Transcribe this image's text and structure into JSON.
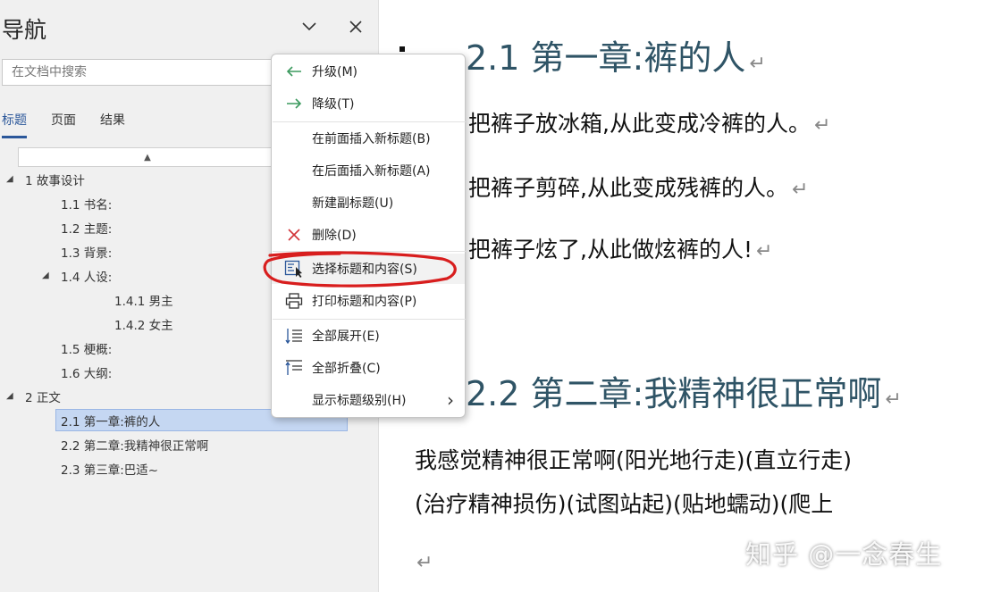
{
  "nav": {
    "title": "导航",
    "search_placeholder": "在文档中搜索",
    "tabs": [
      {
        "label": "标题",
        "active": true
      },
      {
        "label": "页面",
        "active": false
      },
      {
        "label": "结果",
        "active": false
      }
    ],
    "scroll_up_glyph": "▲",
    "tree": [
      {
        "label": "1 故事设计",
        "toggle": "◢"
      },
      {
        "label": "1.1 书名:"
      },
      {
        "label": "1.2 主题:"
      },
      {
        "label": "1.3 背景:"
      },
      {
        "label": "1.4 人设:",
        "toggle": "◢"
      },
      {
        "label": "1.4.1 男主"
      },
      {
        "label": "1.4.2 女主"
      },
      {
        "label": "1.5 梗概:"
      },
      {
        "label": "1.6 大纲:"
      },
      {
        "label": "2 正文",
        "toggle": "◢"
      },
      {
        "label": "2.1 第一章:裤的人",
        "selected": true
      },
      {
        "label": "2.2 第二章:我精神很正常啊"
      },
      {
        "label": "2.3 第三章:巴适~"
      }
    ]
  },
  "context_menu": {
    "items": [
      {
        "label": "升级(M)",
        "icon": "arrow-left-icon"
      },
      {
        "label": "降级(T)",
        "icon": "arrow-right-icon"
      },
      {
        "label": "在前面插入新标题(B)"
      },
      {
        "label": "在后面插入新标题(A)"
      },
      {
        "label": "新建副标题(U)"
      },
      {
        "label": "删除(D)",
        "icon": "close-x-icon"
      },
      {
        "label": "选择标题和内容(S)",
        "icon": "select-content-icon"
      },
      {
        "label": "打印标题和内容(P)",
        "icon": "printer-icon"
      },
      {
        "label": "全部展开(E)",
        "icon": "expand-all-icon"
      },
      {
        "label": "全部折叠(C)",
        "icon": "collapse-all-icon"
      },
      {
        "label": "显示标题级别(H)",
        "submenu_glyph": "›"
      }
    ]
  },
  "document": {
    "heading1": "2.1 第一章:裤的人",
    "para1": "把裤子放冰箱,从此变成冷裤的人。",
    "para2": "把裤子剪碎,从此变成残裤的人。",
    "para3": "把裤子炫了,从此做炫裤的人!",
    "heading2": "2.2 第二章:我精神很正常啊",
    "para4": "我感觉精神很正常啊(阳光地行走)(直立行走)",
    "para5": "(治疗精神损伤)(试图站起)(贴地蠕动)(爬上",
    "paragraph_mark": "↵"
  },
  "watermark": "知乎 @一念春生",
  "colors": {
    "accent": "#2b579a",
    "heading": "#2f5466",
    "selection": "#c5d7f2",
    "annotation_red": "#d81e1e",
    "green_arrow": "#3c9a5f",
    "delete_red": "#d13438"
  }
}
